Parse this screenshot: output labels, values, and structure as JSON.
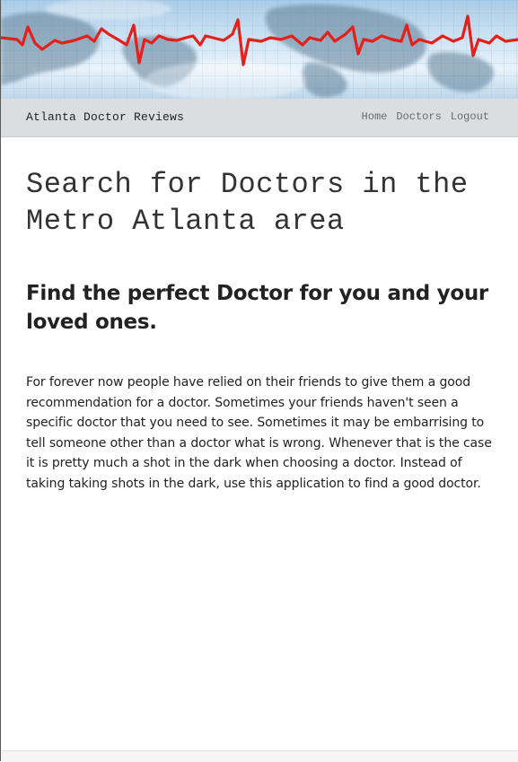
{
  "banner": {
    "image": "heartbeat-ekg-world-map"
  },
  "navbar": {
    "brand": "Atlanta Doctor Reviews",
    "links": [
      "Home",
      "Doctors",
      "Logout"
    ]
  },
  "main": {
    "hero_title": "Search for Doctors in the Metro Atlanta area",
    "sub_title": "Find the perfect Doctor for you and your loved ones.",
    "intro": "For forever now people have relied on their friends to give them a good recommendation for a doctor. Sometimes your friends haven't seen a specific doctor that you need to see. Sometimes it may be embarrising to tell someone other than a doctor what is wrong. Whenever that is the case it is pretty much a shot in the dark when choosing a doctor. Instead of taking taking shots in the dark, use this application to find a good doctor."
  },
  "colors": {
    "ekg_line": "#e3201b",
    "navbar_bg": "#dcdde1"
  }
}
